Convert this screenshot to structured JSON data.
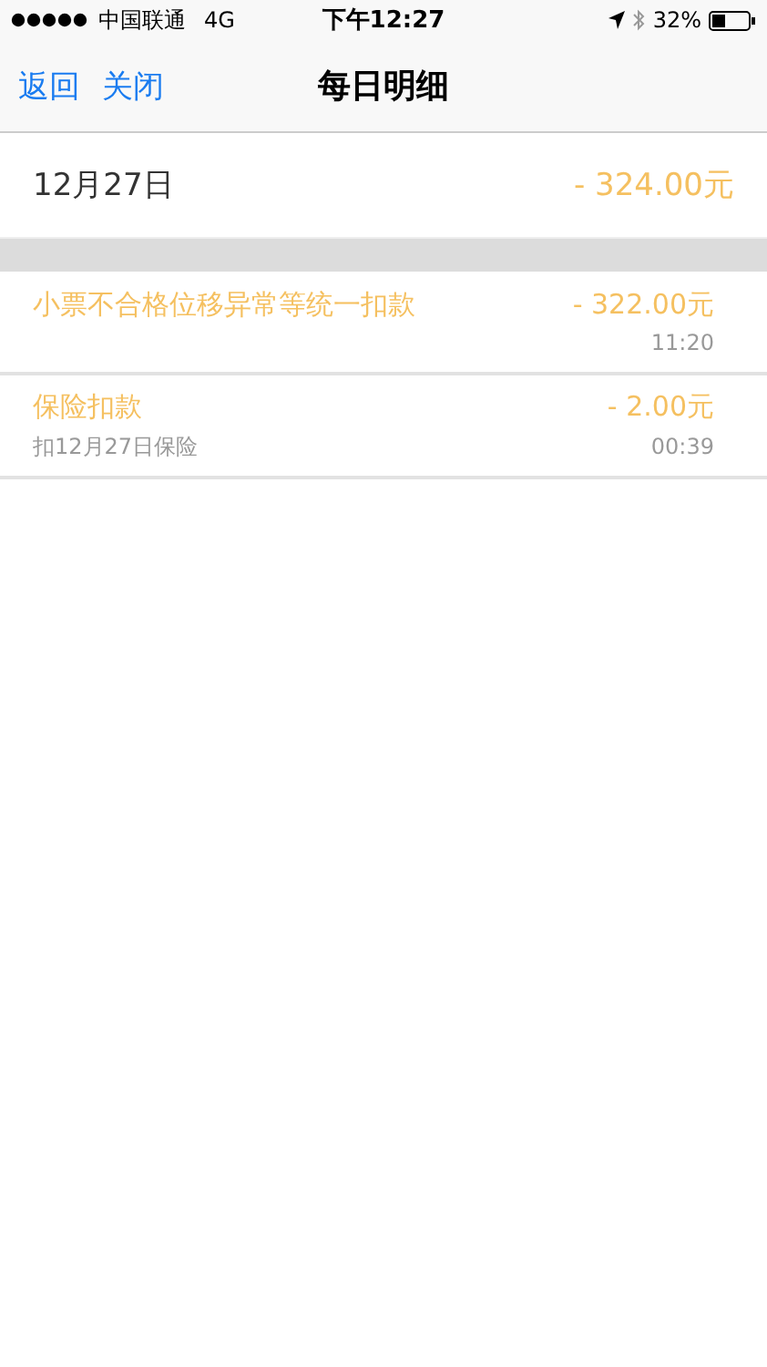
{
  "status_bar": {
    "carrier": "中国联通",
    "network": "4G",
    "time": "下午12:27",
    "battery": "32%"
  },
  "nav_bar": {
    "buttons": [
      "返回",
      "关闭"
    ],
    "title": "每日明细"
  },
  "day": {
    "date": "12月27日",
    "total": "- 324.00元"
  },
  "entries": [
    {
      "title": "小票不合格位移异常等统一扣款",
      "amount": "- 322.00元",
      "time": "11:20"
    },
    {
      "title": "保险扣款",
      "subtitle": "扣12月27日保险",
      "amount": "- 2.00元",
      "time": "00:39"
    }
  ]
}
